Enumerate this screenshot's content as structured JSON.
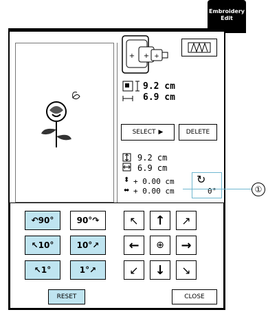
{
  "mode_tab": {
    "line1": "Embroidery",
    "line2": "Edit"
  },
  "size": {
    "height": "9.2 cm",
    "width": "6.9 cm"
  },
  "buttons": {
    "select": "SELECT",
    "delete": "DELETE",
    "reset": "RESET",
    "close": "CLOSE"
  },
  "info": {
    "height": "9.2 cm",
    "width": "6.9 cm",
    "v_offset": "+ 0.00 cm",
    "h_offset": "+ 0.00 cm",
    "angle": "0°"
  },
  "rotation": {
    "left_90": "90°",
    "right_90": "90°",
    "left_10": "10°",
    "right_10": "10°",
    "left_1": "1°",
    "right_1": "1°"
  },
  "callout": {
    "number": "①"
  },
  "colors": {
    "accent": "#bfe4f0",
    "callout": "#6fb7d0"
  }
}
